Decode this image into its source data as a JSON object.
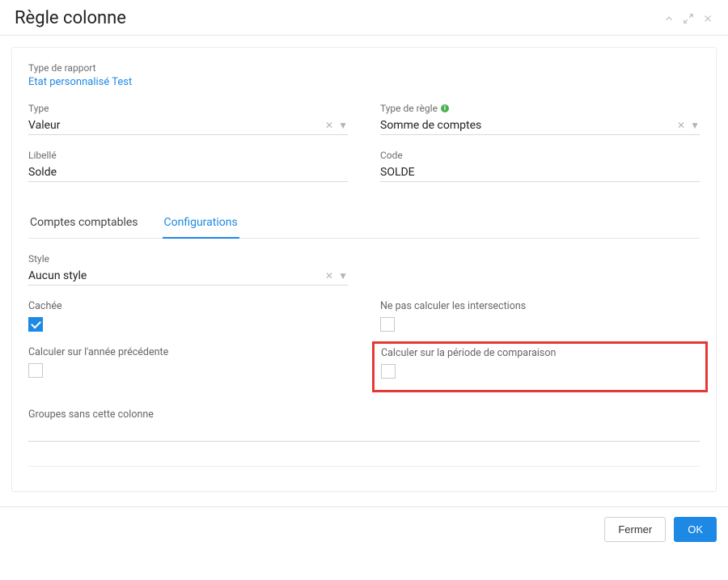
{
  "header": {
    "title": "Règle colonne"
  },
  "report": {
    "label": "Type de rapport",
    "link": "Etat personnalisé Test"
  },
  "fields": {
    "type": {
      "label": "Type",
      "value": "Valeur"
    },
    "rule_type": {
      "label": "Type de règle",
      "value": "Somme de comptes"
    },
    "libelle": {
      "label": "Libellé",
      "value": "Solde"
    },
    "code": {
      "label": "Code",
      "value": "SOLDE"
    },
    "style": {
      "label": "Style",
      "value": "Aucun style"
    }
  },
  "tabs": [
    {
      "id": "accounts",
      "label": "Comptes comptables",
      "active": false
    },
    {
      "id": "config",
      "label": "Configurations",
      "active": true
    }
  ],
  "checks": {
    "hidden": {
      "label": "Cachée",
      "checked": true
    },
    "no_intersect": {
      "label": "Ne pas calculer les intersections",
      "checked": false
    },
    "prev_year": {
      "label": "Calculer sur l'année précédente",
      "checked": false
    },
    "compare_period": {
      "label": "Calculer sur la période de comparaison",
      "checked": false
    }
  },
  "groups": {
    "label": "Groupes sans cette colonne"
  },
  "footer": {
    "close": "Fermer",
    "ok": "OK"
  }
}
